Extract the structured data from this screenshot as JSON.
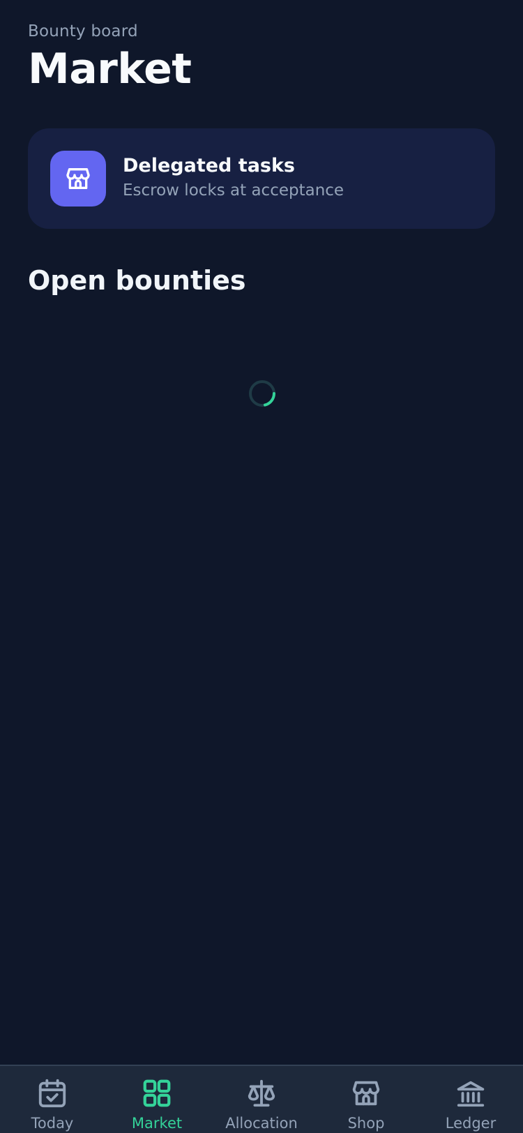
{
  "header": {
    "eyebrow": "Bounty board",
    "title": "Market"
  },
  "info_card": {
    "icon": "store-icon",
    "title": "Delegated tasks",
    "subtitle": "Escrow locks at acceptance"
  },
  "section": {
    "title": "Open bounties",
    "state": "loading"
  },
  "tabs": [
    {
      "label": "Today",
      "icon": "calendar-check-icon",
      "active": false
    },
    {
      "label": "Market",
      "icon": "grid-icon",
      "active": true
    },
    {
      "label": "Allocation",
      "icon": "scale-icon",
      "active": false
    },
    {
      "label": "Shop",
      "icon": "store-icon",
      "active": false
    },
    {
      "label": "Ledger",
      "icon": "bank-icon",
      "active": false
    }
  ],
  "colors": {
    "background": "#0f172a",
    "card": "#172042",
    "accent_icon": "#6366f1",
    "active_tab": "#34d399",
    "inactive_tab": "#94a3b8",
    "tabbar": "#1e293b"
  }
}
